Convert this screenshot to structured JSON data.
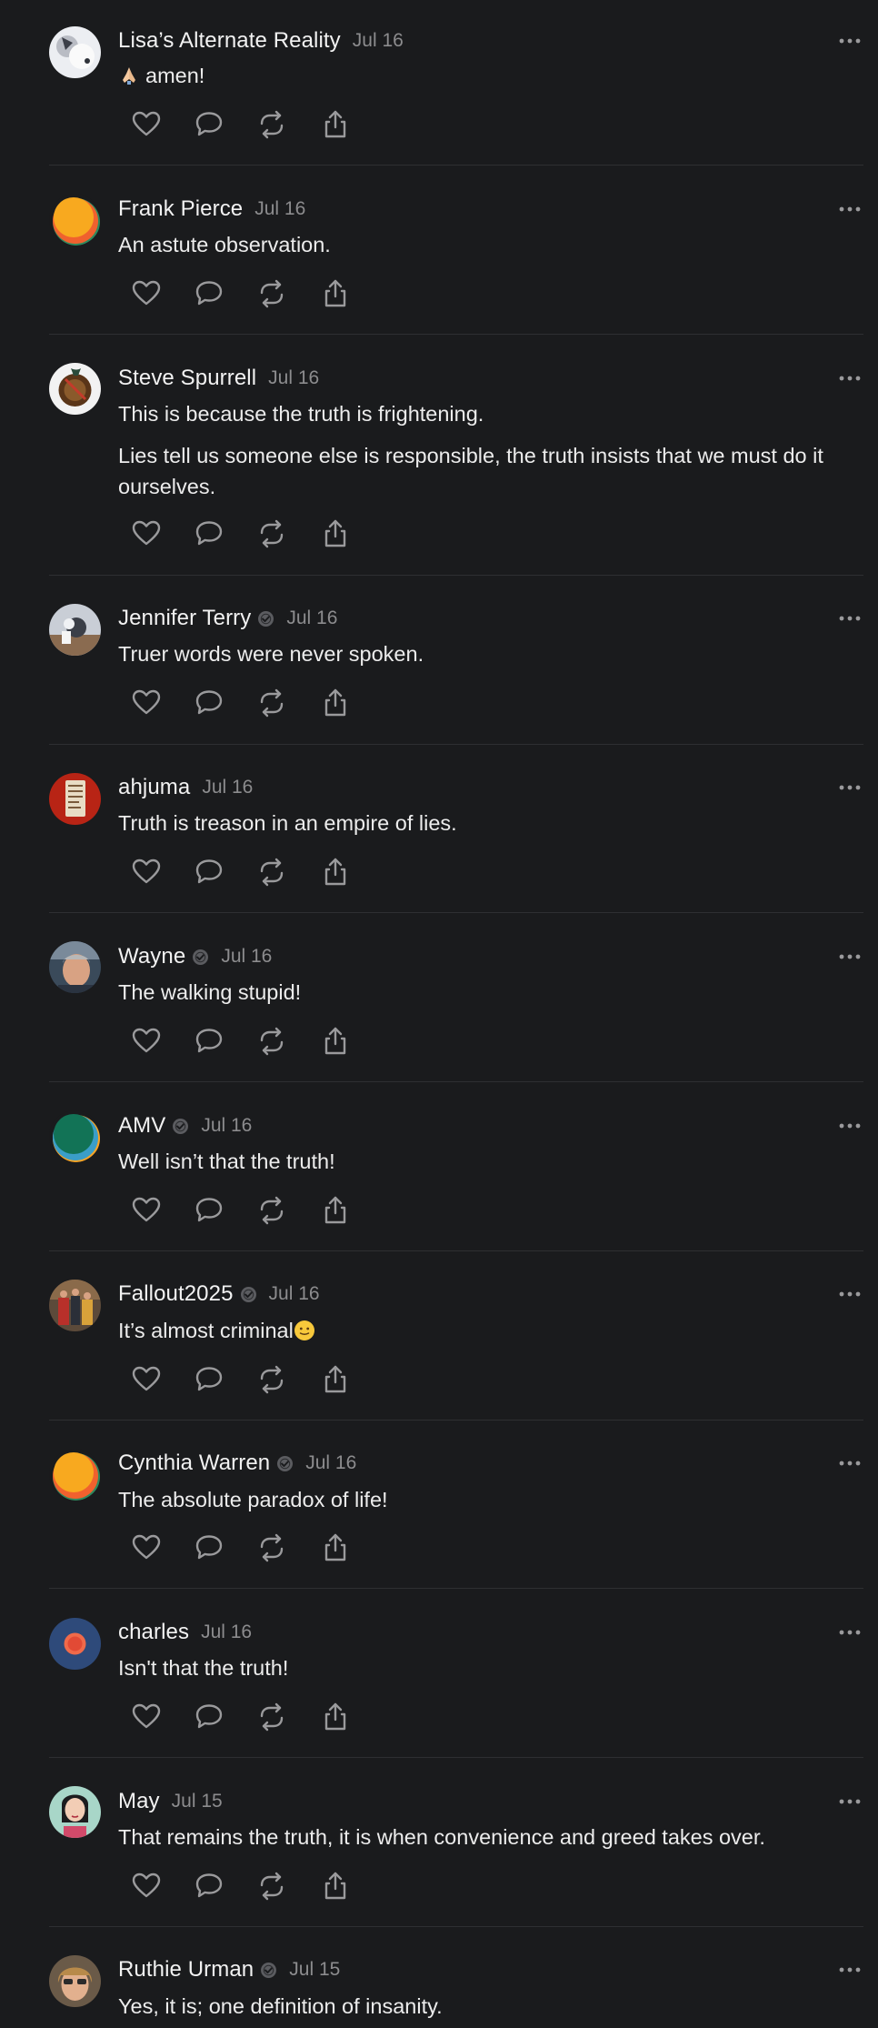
{
  "feed": {
    "posts": [
      {
        "author": "Lisa’s Alternate Reality",
        "time": "Jul 16",
        "verified": false,
        "avatar": "avatar-lisa",
        "leading_emoji": "folded-hands-emoji",
        "paragraphs": [
          "amen!"
        ]
      },
      {
        "author": "Frank Pierce",
        "time": "Jul 16",
        "verified": false,
        "avatar": "avatar-frank",
        "paragraphs": [
          "An astute observation."
        ]
      },
      {
        "author": "Steve Spurrell",
        "time": "Jul 16",
        "verified": false,
        "avatar": "avatar-steve",
        "paragraphs": [
          "This is because the truth is frightening.",
          "Lies tell us someone else is responsible, the truth insists that we must do it ourselves."
        ]
      },
      {
        "author": "Jennifer Terry",
        "time": "Jul 16",
        "verified": true,
        "avatar": "avatar-jennifer",
        "paragraphs": [
          "Truer words were never spoken."
        ]
      },
      {
        "author": "ahjuma",
        "time": "Jul 16",
        "verified": false,
        "avatar": "avatar-ahjuma",
        "paragraphs": [
          "Truth is treason in an empire of lies."
        ]
      },
      {
        "author": "Wayne",
        "time": "Jul 16",
        "verified": true,
        "avatar": "avatar-wayne",
        "paragraphs": [
          "The walking stupid!"
        ]
      },
      {
        "author": "AMV",
        "time": "Jul 16",
        "verified": true,
        "avatar": "avatar-amv",
        "paragraphs": [
          "Well isn’t that the truth!"
        ]
      },
      {
        "author": "Fallout2025",
        "time": "Jul 16",
        "verified": true,
        "avatar": "avatar-fallout",
        "trailing_emoji": "slight-smile-emoji",
        "paragraphs": [
          "It’s almost criminal"
        ]
      },
      {
        "author": "Cynthia Warren",
        "time": "Jul 16",
        "verified": true,
        "avatar": "avatar-cynthia",
        "paragraphs": [
          "The absolute paradox of life!"
        ]
      },
      {
        "author": "charles",
        "time": "Jul 16",
        "verified": false,
        "avatar": "avatar-charles",
        "paragraphs": [
          "Isn't that the truth!"
        ]
      },
      {
        "author": "May",
        "time": "Jul 15",
        "verified": false,
        "avatar": "avatar-may",
        "paragraphs": [
          "That remains the truth, it is when convenience and greed takes over."
        ]
      },
      {
        "author": "Ruthie Urman",
        "time": "Jul 15",
        "verified": true,
        "avatar": "avatar-ruthie",
        "paragraphs": [
          "Yes, it is; one definition of insanity."
        ]
      }
    ]
  },
  "icons": {
    "like": "heart-icon",
    "reply": "comment-icon",
    "repost": "repost-icon",
    "share": "share-icon",
    "more": "more-options-icon",
    "verified": "verified-badge-icon"
  },
  "colors": {
    "background": "#1a1b1d",
    "text": "#ececec",
    "muted": "#8c8c8e",
    "divider": "#2e2f32",
    "icon": "#9a9a9c"
  }
}
